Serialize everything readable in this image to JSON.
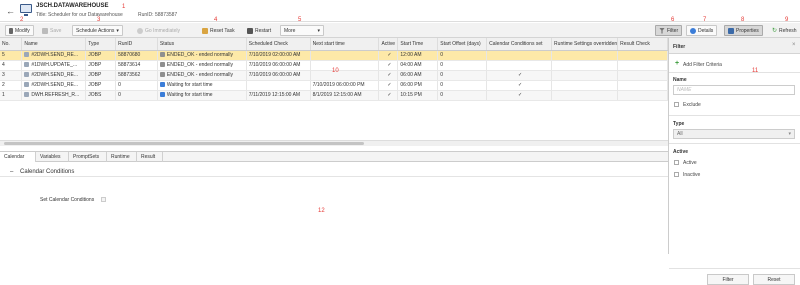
{
  "header": {
    "title": "JSCH.DATAWAREHOUSE",
    "subtitle": "Title: Scheduler for our Datawarehouse",
    "run_id": "RunID: 58873587"
  },
  "toolbar": {
    "modify": "Modify",
    "save": "Save",
    "schedule_actions": "Schedule Actions",
    "go_immediately": "Go Immediately",
    "reset_task": "Reset Task",
    "restart": "Restart",
    "more": "More",
    "filter": "Filter",
    "details": "Details",
    "properties": "Properties",
    "refresh": "Refresh"
  },
  "annotations": [
    "1",
    "2",
    "3",
    "4",
    "5",
    "6",
    "7",
    "8",
    "9",
    "10",
    "11",
    "12"
  ],
  "grid": {
    "columns": [
      "No.",
      "Name",
      "Type",
      "RunID",
      "Status",
      "Scheduled Check",
      "Next start time",
      "Active",
      "Start Time",
      "Start Offset (days)",
      "Calendar Conditions set",
      "Runtime Settings overridden",
      "Result Check"
    ],
    "rows": [
      {
        "no": "5",
        "name": "#2DWH.SEND_RE...",
        "type": "JOBP",
        "runid": "58870680",
        "status": "ENDED_OK - ended normally",
        "status_kind": "ok",
        "sched": "7/10/2019 02:00:00 AM",
        "next": "",
        "active": "✓",
        "start": "12:00 AM",
        "offset": "0",
        "cal": "",
        "runtime": "",
        "result": ""
      },
      {
        "no": "4",
        "name": "#1DWH.UPDATE_...",
        "type": "JOBP",
        "runid": "58873614",
        "status": "ENDED_OK - ended normally",
        "status_kind": "ok",
        "sched": "7/10/2019 06:00:00 AM",
        "next": "",
        "active": "✓",
        "start": "04:00 AM",
        "offset": "0",
        "cal": "",
        "runtime": "",
        "result": ""
      },
      {
        "no": "3",
        "name": "#2DWH.SEND_RE...",
        "type": "JOBP",
        "runid": "58873562",
        "status": "ENDED_OK - ended normally",
        "status_kind": "ok",
        "sched": "7/10/2019 06:00:00 AM",
        "next": "",
        "active": "✓",
        "start": "06:00 AM",
        "offset": "0",
        "cal": "✓",
        "runtime": "",
        "result": ""
      },
      {
        "no": "2",
        "name": "#2DWH.SEND_RE...",
        "type": "JOBP",
        "runid": "0",
        "status": "Waiting for start time",
        "status_kind": "wait",
        "sched": "",
        "next": "7/10/2019 06:00:00 PM",
        "active": "✓",
        "start": "06:00 PM",
        "offset": "0",
        "cal": "✓",
        "runtime": "",
        "result": ""
      },
      {
        "no": "1",
        "name": "DWH.REFRESH_R...",
        "type": "JOBS",
        "runid": "0",
        "status": "Waiting for start time",
        "status_kind": "wait",
        "sched": "7/11/2019 12:15:00 AM",
        "next": "8/1/2019 12:15:00 AM",
        "active": "✓",
        "start": "10:15 PM",
        "offset": "0",
        "cal": "✓",
        "runtime": "",
        "result": ""
      }
    ]
  },
  "bottom_tabs": [
    "Calendar",
    "Variables",
    "PromptSets",
    "Runtime",
    "Result"
  ],
  "calendar": {
    "section": "Calendar Conditions",
    "set_label": "Set Calendar Conditions"
  },
  "filter_panel": {
    "title": "Filter",
    "add_criteria": "Add Filter Criteria",
    "name_label": "Name",
    "name_placeholder": "NAME",
    "exclude": "Exclude",
    "type_label": "Type",
    "type_value": "All",
    "active_label": "Active",
    "active_opt": "Active",
    "inactive_opt": "Inactive",
    "filter_btn": "Filter",
    "reset_btn": "Reset"
  },
  "colors": {
    "accent": "#e53935",
    "selected_row": "#fde9a8",
    "ok_icon": "#8f8f8f",
    "wait_icon": "#3b7dd8",
    "add_icon": "#3a9b3a"
  }
}
